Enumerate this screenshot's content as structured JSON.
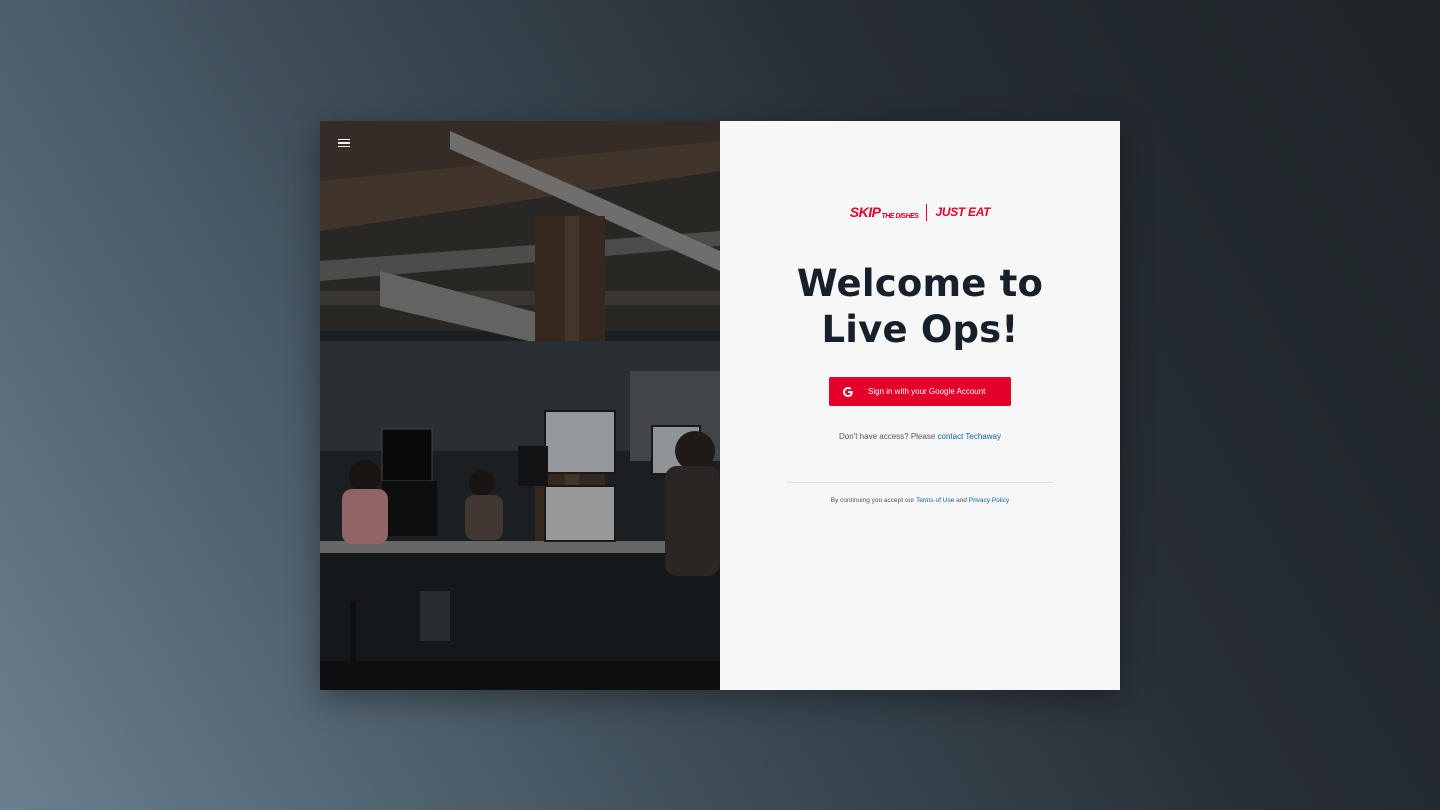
{
  "header": {
    "menu_icon": "hamburger-menu-icon"
  },
  "brand": {
    "skip_main": "SKIP",
    "skip_small": "THE DISHES",
    "just_eat": "JUST EAT",
    "color": "#e4002b"
  },
  "login": {
    "title_line1": "Welcome to",
    "title_line2": "Live Ops!",
    "google_button_label": "Sign in with your Google Account",
    "google_icon": "google-g-icon",
    "access_prefix": "Don't have access? Please",
    "access_link": "contact Techaway",
    "terms_prefix": "By continuing you accept our",
    "terms_link": "Terms of Use",
    "terms_and": "and",
    "privacy_link": "Privacy Policy"
  },
  "colors": {
    "accent": "#e4002b",
    "title": "#17202a",
    "link": "#0b62a8",
    "panel_bg": "#f7f7f7"
  }
}
